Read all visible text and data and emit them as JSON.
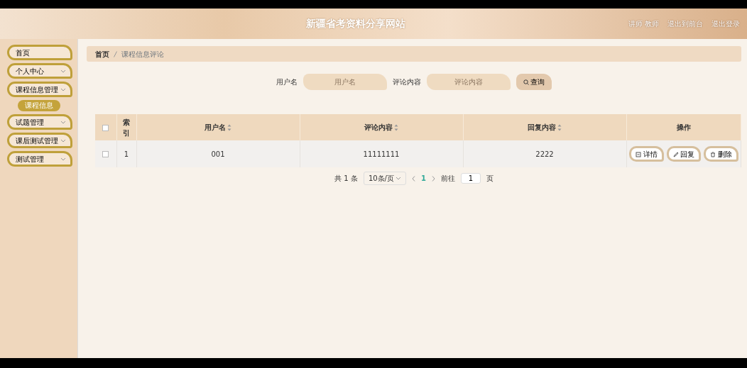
{
  "header": {
    "title": "新疆省考资料分享网站",
    "links": [
      "讲师 教师",
      "退出到前台",
      "退出登录"
    ]
  },
  "sidebar": {
    "items": [
      {
        "label": "首页",
        "expandable": false
      },
      {
        "label": "个人中心",
        "expandable": true
      },
      {
        "label": "课程信息管理",
        "expandable": true,
        "children": [
          {
            "label": "课程信息",
            "selected": true
          }
        ]
      },
      {
        "label": "试题管理",
        "expandable": true
      },
      {
        "label": "课后测试管理",
        "expandable": true
      },
      {
        "label": "测试管理",
        "expandable": true
      }
    ]
  },
  "breadcrumb": [
    "首页",
    "课程信息评论"
  ],
  "search": {
    "fields": [
      {
        "label": "用户名",
        "placeholder": "用户名"
      },
      {
        "label": "评论内容",
        "placeholder": "评论内容"
      }
    ],
    "button": "查询"
  },
  "table": {
    "select_all_checked": false,
    "columns": [
      {
        "label": "索引",
        "sortable": false
      },
      {
        "label": "用户名",
        "sortable": true
      },
      {
        "label": "评论内容",
        "sortable": true
      },
      {
        "label": "回复内容",
        "sortable": true
      },
      {
        "label": "操作",
        "sortable": false
      }
    ],
    "rows": [
      {
        "checked": false,
        "cells": [
          "1",
          "001",
          "11111111",
          "2222"
        ],
        "actions": [
          "详情",
          "回复",
          "删除"
        ]
      }
    ]
  },
  "pagination": {
    "total": "共 1 条",
    "page_size": "10条/页",
    "pages": [
      {
        "label": "1",
        "selected": true
      }
    ],
    "goto_label": "前往",
    "goto_value": "1",
    "goto_suffix": "页"
  }
}
